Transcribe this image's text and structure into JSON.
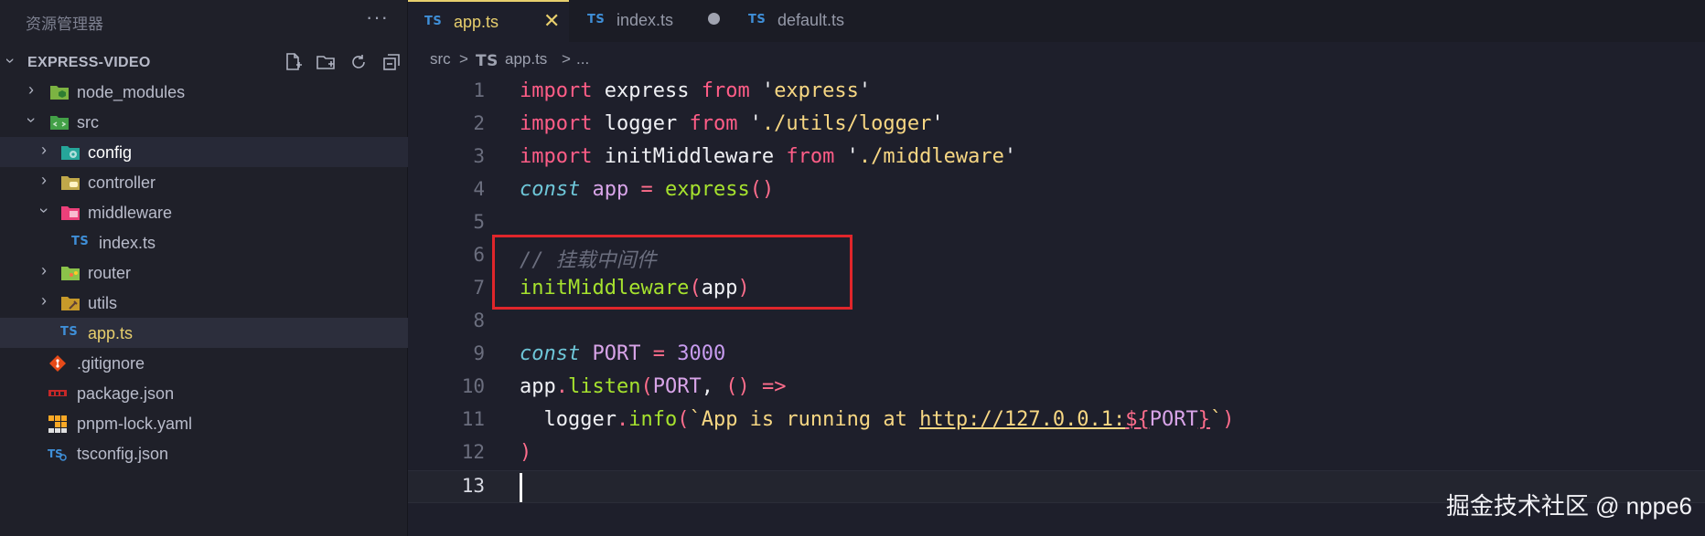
{
  "explorer": {
    "title": "资源管理器",
    "more_label": "···",
    "root": "EXPRESS-VIDEO",
    "actions": [
      "new-file-icon",
      "new-folder-icon",
      "refresh-icon",
      "collapse-all-icon"
    ],
    "tree": [
      {
        "label": "node_modules",
        "depth": 0,
        "type": "folder",
        "expanded": false,
        "icon": "node-folder-icon"
      },
      {
        "label": "src",
        "depth": 0,
        "type": "folder",
        "expanded": true,
        "icon": "src-folder-icon"
      },
      {
        "label": "config",
        "depth": 1,
        "type": "folder",
        "expanded": false,
        "icon": "config-folder-icon"
      },
      {
        "label": "controller",
        "depth": 1,
        "type": "folder",
        "expanded": false,
        "icon": "controller-folder-icon"
      },
      {
        "label": "middleware",
        "depth": 1,
        "type": "folder",
        "expanded": true,
        "icon": "middleware-folder-icon"
      },
      {
        "label": "index.ts",
        "depth": 2,
        "type": "ts",
        "icon": "typescript-icon"
      },
      {
        "label": "router",
        "depth": 1,
        "type": "folder",
        "expanded": false,
        "icon": "router-folder-icon"
      },
      {
        "label": "utils",
        "depth": 1,
        "type": "folder",
        "expanded": false,
        "icon": "utils-folder-icon"
      },
      {
        "label": "app.ts",
        "depth": 1,
        "type": "ts",
        "icon": "typescript-icon"
      },
      {
        "label": ".gitignore",
        "depth": 0,
        "type": "file",
        "icon": "git-icon"
      },
      {
        "label": "package.json",
        "depth": 0,
        "type": "file",
        "icon": "npm-icon"
      },
      {
        "label": "pnpm-lock.yaml",
        "depth": 0,
        "type": "file",
        "icon": "pnpm-icon"
      },
      {
        "label": "tsconfig.json",
        "depth": 0,
        "type": "file",
        "icon": "tsconfig-icon"
      }
    ]
  },
  "tabs": [
    {
      "badge": "TS",
      "label": "app.ts",
      "active": true,
      "close": "✕"
    },
    {
      "badge": "TS",
      "label": "index.ts",
      "active": false,
      "modified": true
    },
    {
      "badge": "TS",
      "label": "default.ts",
      "active": false
    }
  ],
  "breadcrumb": {
    "folder": "src",
    "sep": ">",
    "badge": "TS",
    "file": "app.ts",
    "tail": "..."
  },
  "editor": {
    "line_numbers": [
      "1",
      "2",
      "3",
      "4",
      "5",
      "6",
      "7",
      "8",
      "9",
      "10",
      "11",
      "12",
      "13"
    ],
    "current_line": "13",
    "lines": [
      [
        [
          "kw",
          "import"
        ],
        [
          "plain",
          " express "
        ],
        [
          "kw",
          "from"
        ],
        [
          "plain",
          " '"
        ],
        [
          "str",
          "express"
        ],
        [
          "plain",
          "'"
        ]
      ],
      [
        [
          "kw",
          "import"
        ],
        [
          "plain",
          " logger "
        ],
        [
          "kw",
          "from"
        ],
        [
          "plain",
          " '"
        ],
        [
          "str",
          "./utils/logger"
        ],
        [
          "plain",
          "'"
        ]
      ],
      [
        [
          "kw",
          "import"
        ],
        [
          "plain",
          " initMiddleware "
        ],
        [
          "kw",
          "from"
        ],
        [
          "plain",
          " '"
        ],
        [
          "str",
          "./middleware"
        ],
        [
          "plain",
          "'"
        ]
      ],
      [
        [
          "con",
          "const"
        ],
        [
          "plain",
          " "
        ],
        [
          "var",
          "app"
        ],
        [
          "plain",
          " "
        ],
        [
          "op",
          "="
        ],
        [
          "plain",
          " "
        ],
        [
          "fn",
          "express"
        ],
        [
          "par",
          "()"
        ]
      ],
      [],
      [
        [
          "cm",
          "// 挂载中间件"
        ]
      ],
      [
        [
          "fn",
          "initMiddleware"
        ],
        [
          "par",
          "("
        ],
        [
          "plain",
          "app"
        ],
        [
          "par",
          ")"
        ]
      ],
      [],
      [
        [
          "con",
          "const"
        ],
        [
          "plain",
          " "
        ],
        [
          "var",
          "PORT"
        ],
        [
          "plain",
          " "
        ],
        [
          "op",
          "="
        ],
        [
          "plain",
          " "
        ],
        [
          "num",
          "3000"
        ]
      ],
      [
        [
          "plain",
          "app"
        ],
        [
          "op",
          "."
        ],
        [
          "fn",
          "listen"
        ],
        [
          "par",
          "("
        ],
        [
          "var",
          "PORT"
        ],
        [
          "plain",
          ", "
        ],
        [
          "par",
          "()"
        ],
        [
          "plain",
          " "
        ],
        [
          "op",
          "=>"
        ]
      ],
      [
        [
          "plain",
          "  logger"
        ],
        [
          "op",
          "."
        ],
        [
          "fn",
          "info"
        ],
        [
          "par",
          "("
        ],
        [
          "str",
          "`App is running at "
        ],
        [
          "url",
          "http://127.0.0.1:"
        ],
        [
          "tpl",
          "${"
        ],
        [
          "var",
          "PORT"
        ],
        [
          "tpl",
          "}"
        ],
        [
          "str",
          "`"
        ],
        [
          "par",
          ")"
        ]
      ],
      [
        [
          "par",
          ")"
        ]
      ],
      []
    ]
  },
  "watermark": "掘金技术社区 @ nppe6",
  "colors": {
    "accent": "#e8cf6d",
    "highlight_box": "#e0262b",
    "keyword": "#ff5d87",
    "string": "#f7d783",
    "function": "#a6e22e"
  }
}
